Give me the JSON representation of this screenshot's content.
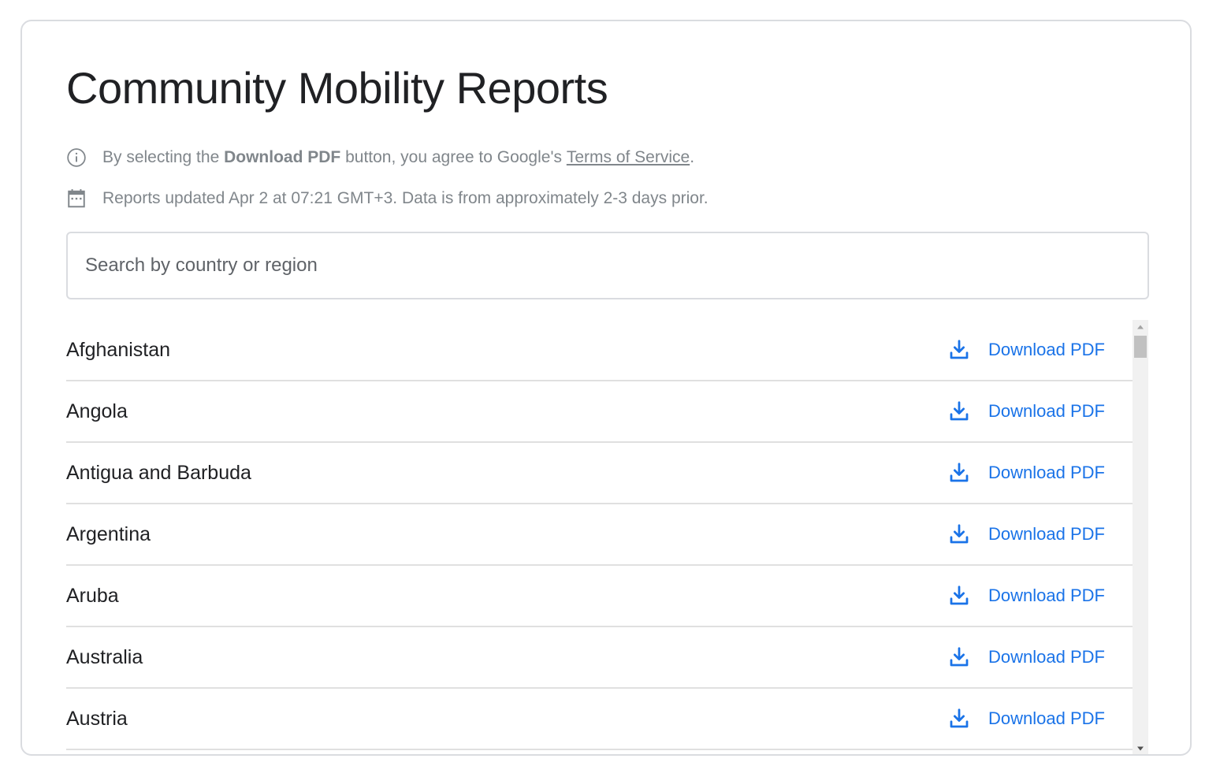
{
  "page": {
    "title": "Community Mobility Reports"
  },
  "info": {
    "terms_prefix": "By selecting the ",
    "terms_bold": "Download PDF",
    "terms_middle": " button, you agree to Google's ",
    "terms_link": "Terms of Service",
    "terms_suffix": ".",
    "updated_text": "Reports updated Apr 2 at 07:21 GMT+3. Data is from approximately 2-3 days prior.",
    "info_icon": "info-icon",
    "calendar_icon": "calendar-icon"
  },
  "search": {
    "placeholder": "Search by country or region",
    "value": ""
  },
  "list": {
    "download_label": "Download PDF",
    "download_icon": "download-icon",
    "items": [
      {
        "name": "Afghanistan"
      },
      {
        "name": "Angola"
      },
      {
        "name": "Antigua and Barbuda"
      },
      {
        "name": "Argentina"
      },
      {
        "name": "Aruba"
      },
      {
        "name": "Australia"
      },
      {
        "name": "Austria"
      }
    ]
  },
  "colors": {
    "accent": "#1a73e8",
    "text": "#202124",
    "muted": "#80868b",
    "border": "#dadce0"
  }
}
